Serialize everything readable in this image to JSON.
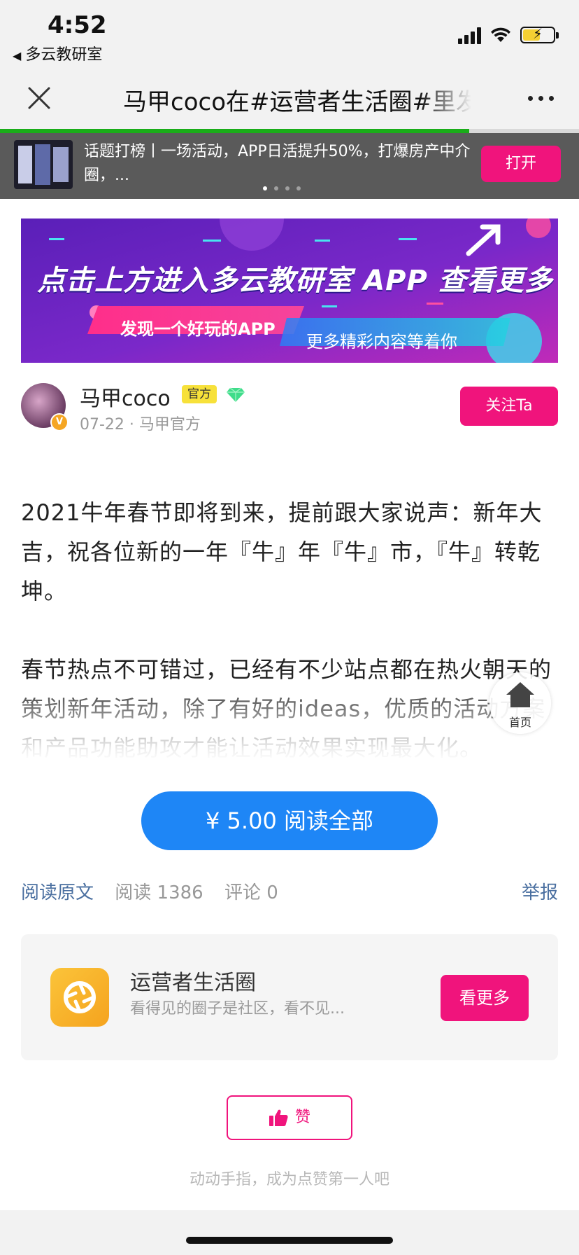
{
  "status_bar": {
    "time": "4:52",
    "back_app": "多云教研室"
  },
  "navbar": {
    "title": "马甲coco在#运营者生活圈#里发",
    "progress_fraction": 0.81
  },
  "promo": {
    "text": "话题打榜丨一场活动，APP日活提升50%，打爆房产中介圈，...",
    "open_label": "打开",
    "dots": 4,
    "active_dot": 0
  },
  "banner": {
    "title": "点击上方进入多云教研室 APP 查看更多",
    "pill_left": "发现一个好玩的APP",
    "pill_right": "更多精彩内容等着你"
  },
  "author": {
    "name": "马甲coco",
    "tag": "官方",
    "meta": "07-22 · 马甲官方",
    "follow_label": "关注Ta"
  },
  "article": {
    "paragraphs": [
      "2021牛年春节即将到来，提前跟大家说声：新年大吉，祝各位新的一年『牛』年『牛』市，『牛』转乾坤。",
      "春节热点不可错过，已经有不少站点都在热火朝天的策划新年活动，除了有好的ideas，优质的活动方案和产品功能助攻才能让活动效果实现最大化。"
    ]
  },
  "home_float": {
    "label": "首页"
  },
  "read_all": {
    "label": "¥ 5.00 阅读全部"
  },
  "meta_row": {
    "read_original": "阅读原文",
    "reads": "阅读 1386",
    "comments": "评论 0",
    "report": "举报"
  },
  "circle": {
    "name": "运营者生活圈",
    "desc": "看得见的圈子是社区，看不见...",
    "more_label": "看更多"
  },
  "like": {
    "label": "赞",
    "hint": "动动手指，成为点赞第一人吧"
  },
  "colors": {
    "accent_pink": "#f0147c",
    "button_blue": "#1e86f6",
    "link_blue": "#4a6fa0",
    "progress_green": "#1aad19"
  }
}
